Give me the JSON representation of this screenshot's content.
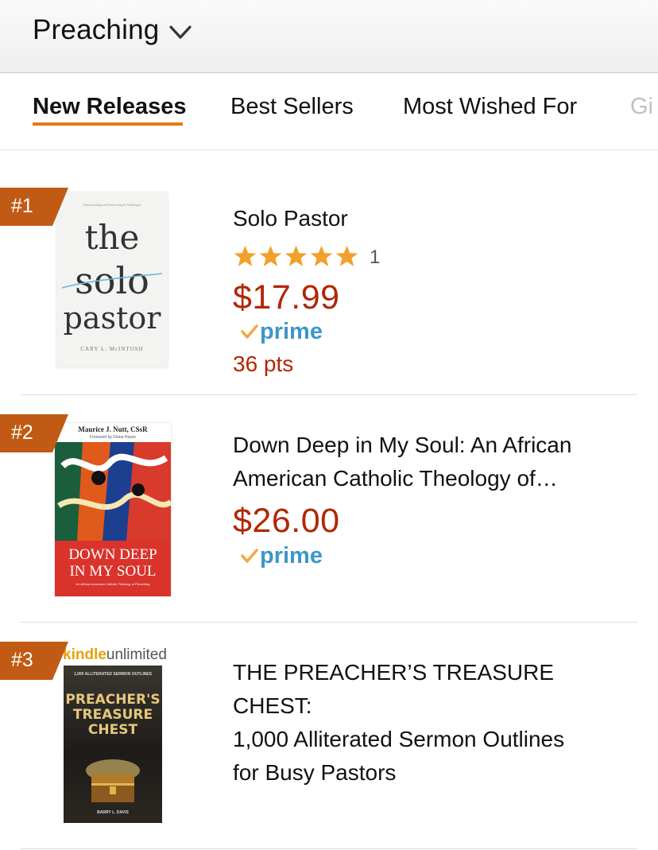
{
  "header": {
    "category": "Preaching"
  },
  "tabs": [
    {
      "label": "New Releases",
      "active": true
    },
    {
      "label": "Best Sellers"
    },
    {
      "label": "Most Wished For"
    },
    {
      "label": "Gi"
    }
  ],
  "colors": {
    "accent": "#e47911",
    "rank_badge": "#c15a14",
    "price": "#b12704",
    "prime": "#3d97c9",
    "star": "#f0a12c"
  },
  "products": [
    {
      "rank": "#1",
      "title": "Solo Pastor",
      "rating_stars": 5,
      "review_count": "1",
      "price": "$17.99",
      "prime": "prime",
      "points": "36 pts",
      "cover": {
        "line_top": "Understanding and Performing Its Challenges",
        "word1": "the",
        "word2": "solo",
        "word3": "pastor",
        "author": "CARY L. McINTOSH"
      }
    },
    {
      "rank": "#2",
      "title_line1": "Down Deep in My Soul: An African",
      "title_line2": "American Catholic Theology of…",
      "price": "$26.00",
      "prime": "prime",
      "cover": {
        "author": "Maurice J. Nutt, CSsR",
        "foreword": "Foreword by Diana Hayes",
        "title_line1": "DOWN DEEP",
        "title_line2": "IN MY SOUL",
        "subtitle": "An African American Catholic Theology of Preaching"
      }
    },
    {
      "rank": "#3",
      "title_line1": "THE PREACHER’S TREASURE CHEST:",
      "title_line2": "1,000 Alliterated Sermon Outlines",
      "title_line3": "for Busy Pastors",
      "kindle_prefix": "kindle",
      "kindle_suffix": "unlimited",
      "cover": {
        "top": "1,000 ALLITERATED SERMON OUTLINES",
        "title_line1": "PREACHER'S",
        "title_line2": "TREASURE",
        "title_line3": "CHEST",
        "author": "BARRY L. DAVIS"
      }
    }
  ]
}
